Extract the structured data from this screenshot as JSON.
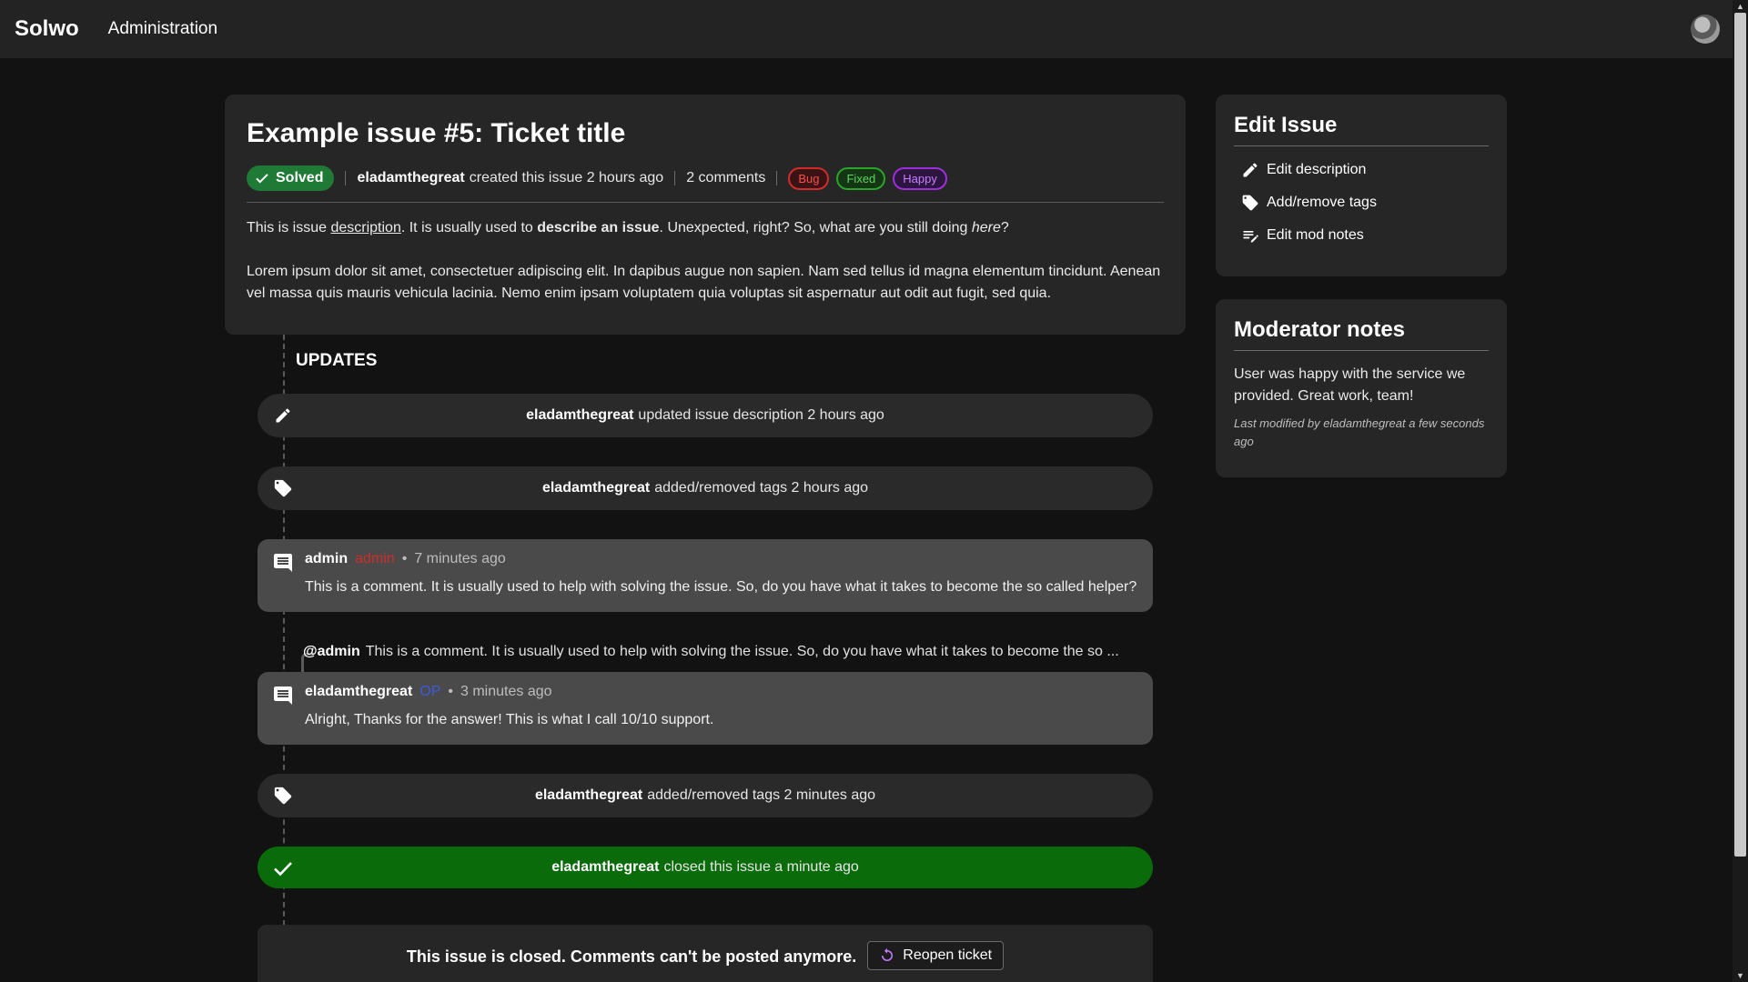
{
  "topbar": {
    "brand": "Solwo",
    "nav_administration": "Administration"
  },
  "issue": {
    "title": "Example issue #5: Ticket title",
    "status": "Solved",
    "author": "eladamthegreat",
    "created_text": "created this issue 2 hours ago",
    "comments_count": "2 comments",
    "tags": [
      "Bug",
      "Fixed",
      "Happy"
    ],
    "desc_p1_a": "This is issue ",
    "desc_p1_link": "description",
    "desc_p1_b": ". It is usually used to ",
    "desc_p1_bold": "describe an issue",
    "desc_p1_c": ". Unexpected, right? So, what are you still doing ",
    "desc_p1_italic": "here",
    "desc_p1_d": "?",
    "desc_p2": "Lorem ipsum dolor sit amet, consectetuer adipiscing elit. In dapibus augue non sapien. Nam sed tellus id magna elementum tincidunt. Aenean vel massa quis mauris vehicula lacinia. Nemo enim ipsam voluptatem quia voluptas sit aspernatur aut odit aut fugit, sed quia."
  },
  "updates": {
    "heading": "UPDATES",
    "events": [
      {
        "user": "eladamthegreat",
        "text": "updated issue description 2 hours ago",
        "icon": "pencil-icon"
      },
      {
        "user": "eladamthegreat",
        "text": "added/removed tags 2 hours ago",
        "icon": "tag-icon"
      },
      {
        "user": "eladamthegreat",
        "text": "added/removed tags 2 minutes ago",
        "icon": "tag-icon"
      },
      {
        "user": "eladamthegreat",
        "text": "closed this issue a minute ago",
        "icon": "check-icon"
      }
    ],
    "comments": [
      {
        "author": "admin",
        "role": "admin",
        "dot": "•",
        "time": "7 minutes ago",
        "body": "This is a comment. It is usually used to help with solving the issue. So, do you have what it takes to become the so called helper?"
      },
      {
        "author": "eladamthegreat",
        "role": "OP",
        "dot": "•",
        "time": "3 minutes ago",
        "body": "Alright, Thanks for the answer! This is what I call 10/10 support."
      }
    ],
    "reply_quote": {
      "mention": "@admin",
      "text": "This is a comment. It is usually used to help with solving the issue. So, do you have what it takes to become the so ..."
    },
    "closed_notice": "This issue is closed. Comments can't be posted anymore.",
    "reopen_label": "Reopen ticket"
  },
  "sidebar": {
    "edit_title": "Edit Issue",
    "edit_items": [
      "Edit description",
      "Add/remove tags",
      "Edit mod notes"
    ],
    "notes_title": "Moderator notes",
    "notes_text": "User was happy with the service we provided. Great work, team!",
    "notes_meta": "Last modified by eladamthegreat a few seconds ago"
  },
  "colors": {
    "background": "#121212",
    "card": "#262626",
    "solved_green": "#1f7a35",
    "closed_green": "#0a6b0a",
    "admin_red": "#d02c2c",
    "op_blue": "#3b5bd9"
  }
}
